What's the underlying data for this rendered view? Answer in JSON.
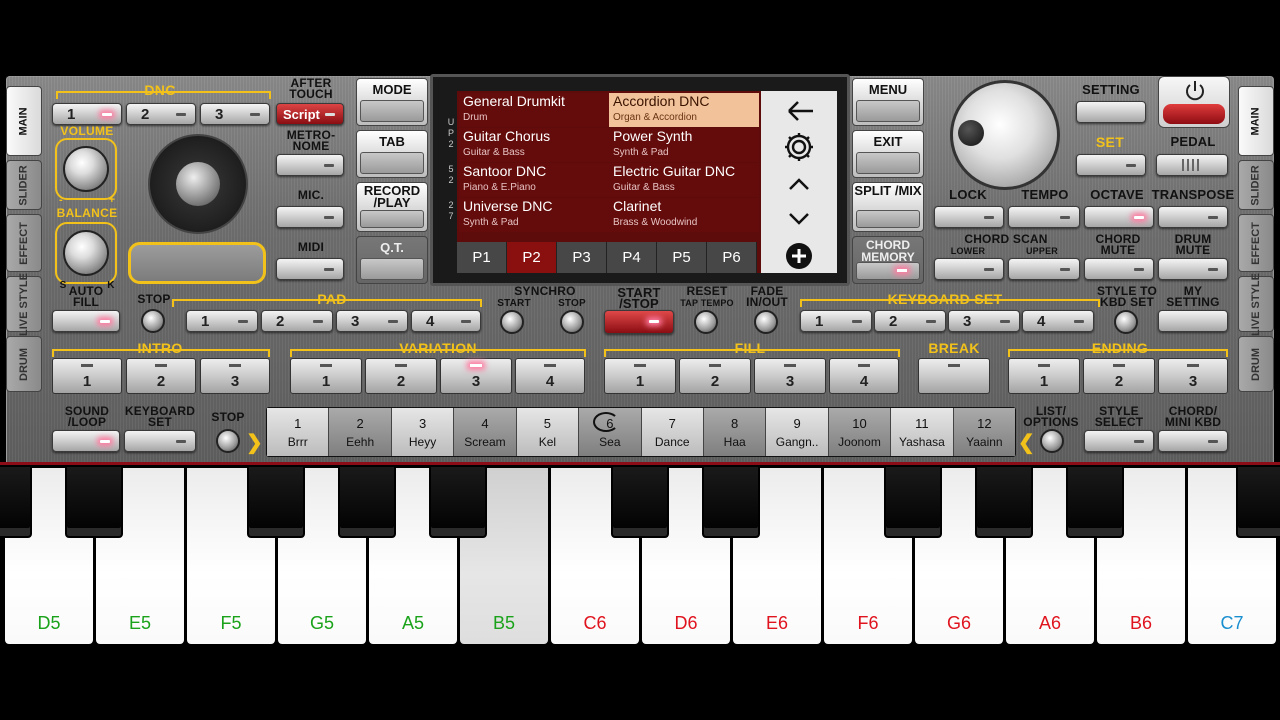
{
  "side_tabs_left": [
    "MAIN",
    "SLIDER",
    "EFFECT",
    "LIVE STYLE",
    "DRUM"
  ],
  "side_tabs_right": [
    "MAIN",
    "SLIDER",
    "EFFECT",
    "LIVE STYLE",
    "DRUM"
  ],
  "dnc": {
    "label": "DNC",
    "buttons": [
      "1",
      "2",
      "3"
    ],
    "aftertouch_label": "AFTER TOUCH",
    "script_label": "Script"
  },
  "volume_label": "VOLUME",
  "balance_label": "BALANCE",
  "balance_minus": "-",
  "balance_plus": "+",
  "balance_s": "S",
  "balance_k": "K",
  "metronome_label": "METRO- NOME",
  "mic_label": "MIC.",
  "midi_label": "MIDI",
  "mode_buttons": {
    "mode": "MODE",
    "tab": "TAB",
    "record": "RECORD /PLAY",
    "qt": "Q.T."
  },
  "right_mode_buttons": {
    "menu": "MENU",
    "exit": "EXIT",
    "split": "SPLIT /MIX",
    "chord_memory": "CHORD MEMORY"
  },
  "display": {
    "side_letters": [
      "U",
      "P",
      "2",
      "5",
      "2",
      "2",
      "7"
    ],
    "cells": [
      {
        "name": "General Drumkit",
        "cat": "Drum",
        "selected": false
      },
      {
        "name": "Accordion DNC",
        "cat": "Organ & Accordion",
        "selected": true
      },
      {
        "name": "Guitar Chorus",
        "cat": "Guitar & Bass",
        "selected": false
      },
      {
        "name": "Power Synth",
        "cat": "Synth & Pad",
        "selected": false
      },
      {
        "name": "Santoor DNC",
        "cat": "Piano & E.Piano",
        "selected": false
      },
      {
        "name": "Electric Guitar DNC",
        "cat": "Guitar & Bass",
        "selected": false
      },
      {
        "name": "Universe DNC",
        "cat": "Synth & Pad",
        "selected": false
      },
      {
        "name": "Clarinet",
        "cat": "Brass & Woodwind",
        "selected": false
      }
    ],
    "pages": [
      "P1",
      "P2",
      "P3",
      "P4",
      "P5",
      "P6"
    ],
    "active_page": "P2"
  },
  "top_right": {
    "setting": "SETTING",
    "set": "SET",
    "pedal": "PEDAL",
    "lock": "LOCK",
    "tempo": "TEMPO",
    "octave": "OCTAVE",
    "transpose": "TRANSPOSE",
    "chord_scan": "CHORD SCAN",
    "lower": "LOWER",
    "upper": "UPPER",
    "chord_mute": "CHORD MUTE",
    "drum_mute": "DRUM MUTE"
  },
  "row2": {
    "auto_fill": "AUTO FILL",
    "stop": "STOP",
    "pad": "PAD",
    "pad_buttons": [
      "1",
      "2",
      "3",
      "4"
    ],
    "synchro": "SYNCHRO",
    "synchro_start": "START",
    "synchro_stop": "STOP",
    "start_stop": "START /STOP",
    "reset": "RESET",
    "tap_tempo": "TAP TEMPO",
    "fade": "FADE IN/OUT",
    "keyboard_set": "KEYBOARD SET",
    "kbd_buttons": [
      "1",
      "2",
      "3",
      "4"
    ],
    "style_to_kbd": "STYLE TO KBD SET",
    "my_setting": "MY SETTING"
  },
  "row3": {
    "intro": "INTRO",
    "intro_buttons": [
      "1",
      "2",
      "3"
    ],
    "variation": "VARIATION",
    "variation_buttons": [
      "1",
      "2",
      "3",
      "4"
    ],
    "fill": "FILL",
    "fill_buttons": [
      "1",
      "2",
      "3",
      "4"
    ],
    "break": "BREAK",
    "ending": "ENDING",
    "ending_buttons": [
      "1",
      "2",
      "3"
    ]
  },
  "row4": {
    "sound_loop": "SOUND /LOOP",
    "keyboard_set": "KEYBOARD SET",
    "stop": "STOP",
    "list_options": "LIST/ OPTIONS",
    "style_select": "STYLE SELECT",
    "chord_mini": "CHORD/ MINI KBD"
  },
  "presets": [
    {
      "n": "1",
      "name": "Brrr"
    },
    {
      "n": "2",
      "name": "Eehh"
    },
    {
      "n": "3",
      "name": "Heyy"
    },
    {
      "n": "4",
      "name": "Scream"
    },
    {
      "n": "5",
      "name": "Kel"
    },
    {
      "n": "6",
      "name": "Sea"
    },
    {
      "n": "7",
      "name": "Dance"
    },
    {
      "n": "8",
      "name": "Haa"
    },
    {
      "n": "9",
      "name": "Gangn.."
    },
    {
      "n": "10",
      "name": "Joonom"
    },
    {
      "n": "11",
      "name": "Yashasa"
    },
    {
      "n": "12",
      "name": "Yaainn"
    }
  ],
  "keys": [
    {
      "note": "D5",
      "color": "#1aa31a"
    },
    {
      "note": "E5",
      "color": "#1aa31a"
    },
    {
      "note": "F5",
      "color": "#1aa31a"
    },
    {
      "note": "G5",
      "color": "#1aa31a"
    },
    {
      "note": "A5",
      "color": "#1aa31a"
    },
    {
      "note": "B5",
      "color": "#1aa31a"
    },
    {
      "note": "C6",
      "color": "#e0141e"
    },
    {
      "note": "D6",
      "color": "#e0141e"
    },
    {
      "note": "E6",
      "color": "#e0141e"
    },
    {
      "note": "F6",
      "color": "#e0141e"
    },
    {
      "note": "G6",
      "color": "#e0141e"
    },
    {
      "note": "A6",
      "color": "#e0141e"
    },
    {
      "note": "B6",
      "color": "#e0141e"
    },
    {
      "note": "C7",
      "color": "#1a8fd0"
    }
  ]
}
